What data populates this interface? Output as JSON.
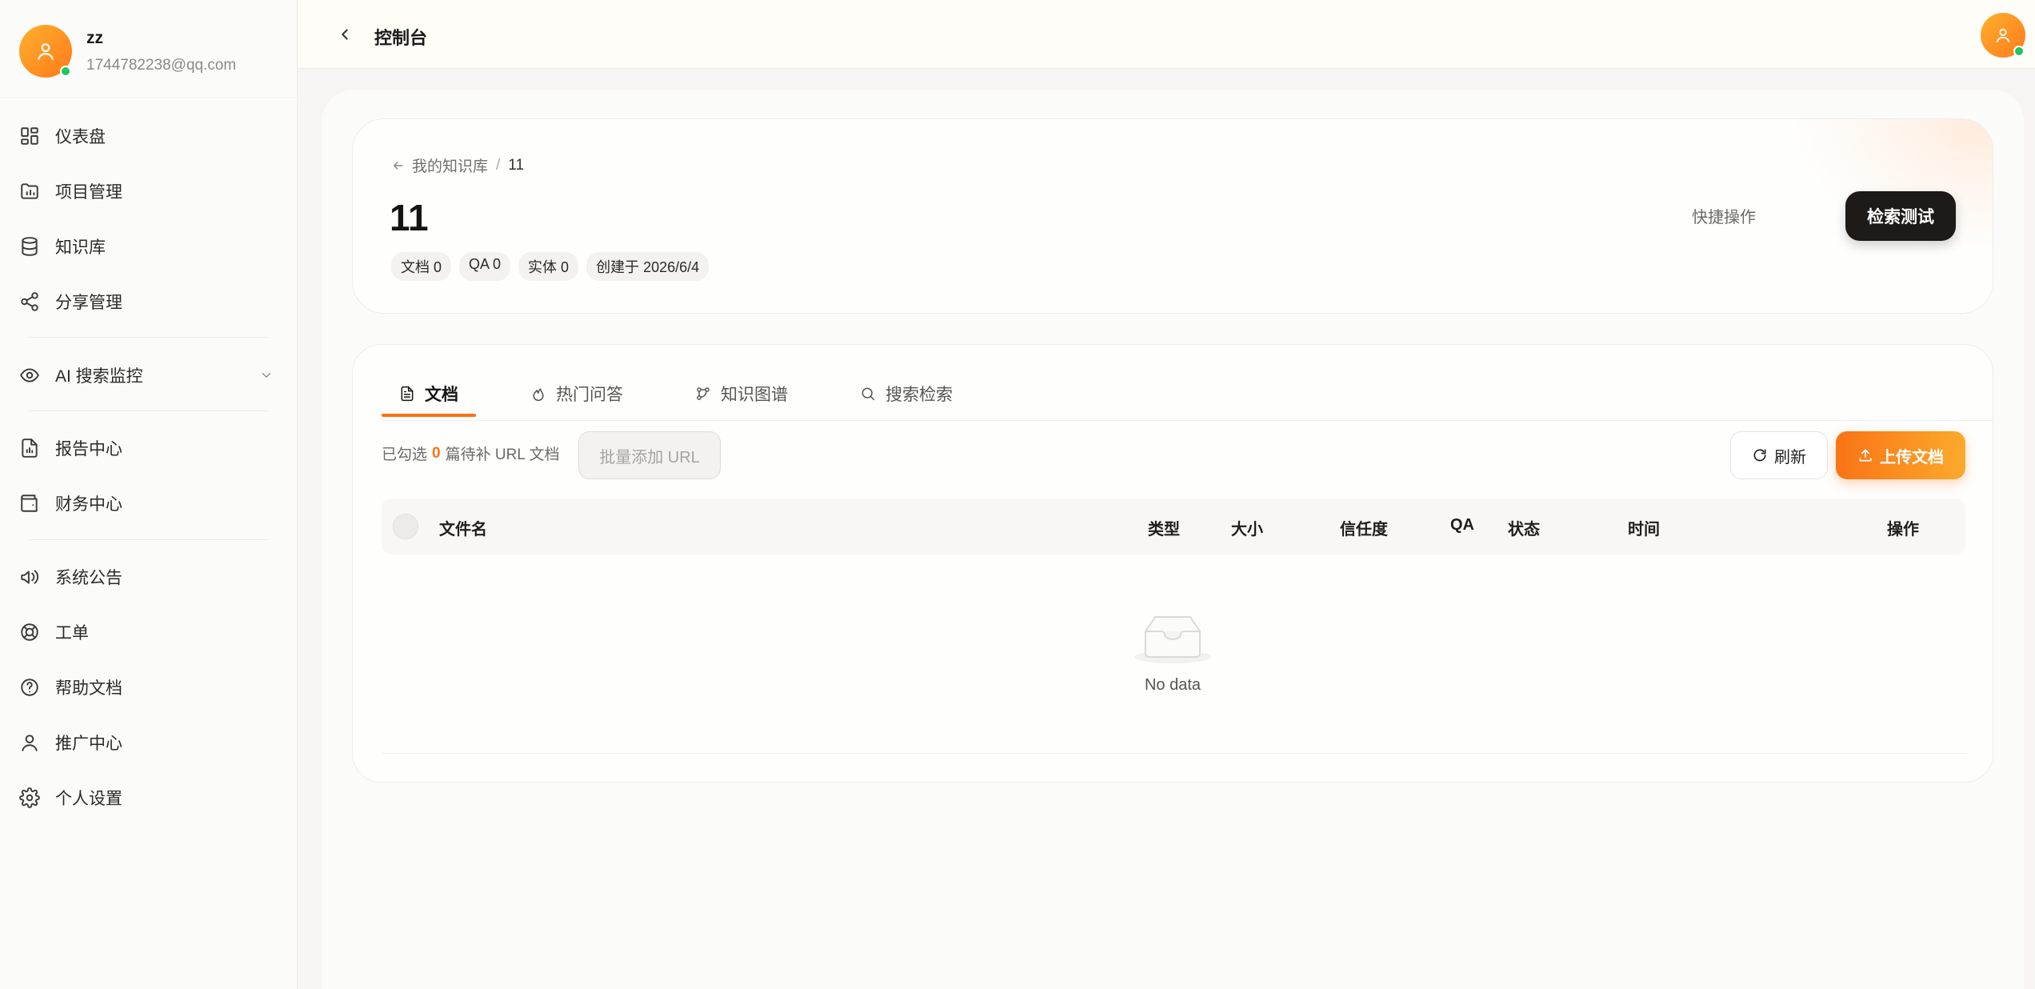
{
  "user": {
    "name": "zz",
    "email": "1744782238@qq.com"
  },
  "sidebar": {
    "items": [
      {
        "label": "仪表盘",
        "icon": "dashboard-icon"
      },
      {
        "label": "项目管理",
        "icon": "folder-chart-icon"
      },
      {
        "label": "知识库",
        "icon": "database-icon"
      },
      {
        "label": "分享管理",
        "icon": "share-icon"
      },
      {
        "label": "AI 搜索监控",
        "icon": "eye-icon"
      },
      {
        "label": "报告中心",
        "icon": "report-icon"
      },
      {
        "label": "财务中心",
        "icon": "wallet-icon"
      },
      {
        "label": "系统公告",
        "icon": "megaphone-icon"
      },
      {
        "label": "工单",
        "icon": "lifebuoy-icon"
      },
      {
        "label": "帮助文档",
        "icon": "help-icon"
      },
      {
        "label": "推广中心",
        "icon": "user-icon"
      },
      {
        "label": "个人设置",
        "icon": "gear-icon"
      }
    ]
  },
  "topbar": {
    "title": "控制台"
  },
  "hero": {
    "breadcrumb_parent": "我的知识库",
    "breadcrumb_sep": "/",
    "breadcrumb_current": "11",
    "title": "11",
    "tags": [
      "文档 0",
      "QA 0",
      "实体 0",
      "创建于 2026/6/4"
    ],
    "quick_ops": "快捷操作",
    "search_test": "检索测试"
  },
  "tabs": [
    {
      "label": "文档",
      "icon": "file-icon",
      "active": true
    },
    {
      "label": "热门问答",
      "icon": "flame-icon",
      "active": false
    },
    {
      "label": "知识图谱",
      "icon": "graph-icon",
      "active": false
    },
    {
      "label": "搜索检索",
      "icon": "search-icon",
      "active": false
    }
  ],
  "toolbar": {
    "selected_prefix": "已勾选",
    "selected_count": "0",
    "selected_suffix": "篇待补 URL 文档",
    "batch_add_url": "批量添加 URL",
    "refresh": "刷新",
    "upload": "上传文档"
  },
  "table": {
    "columns": [
      "文件名",
      "类型",
      "大小",
      "信任度",
      "QA",
      "状态",
      "时间",
      "操作"
    ],
    "rows": [],
    "empty_text": "No data"
  },
  "colors": {
    "accent": "#f97316",
    "online": "#22c55e",
    "dark_button": "#1d1a18"
  }
}
